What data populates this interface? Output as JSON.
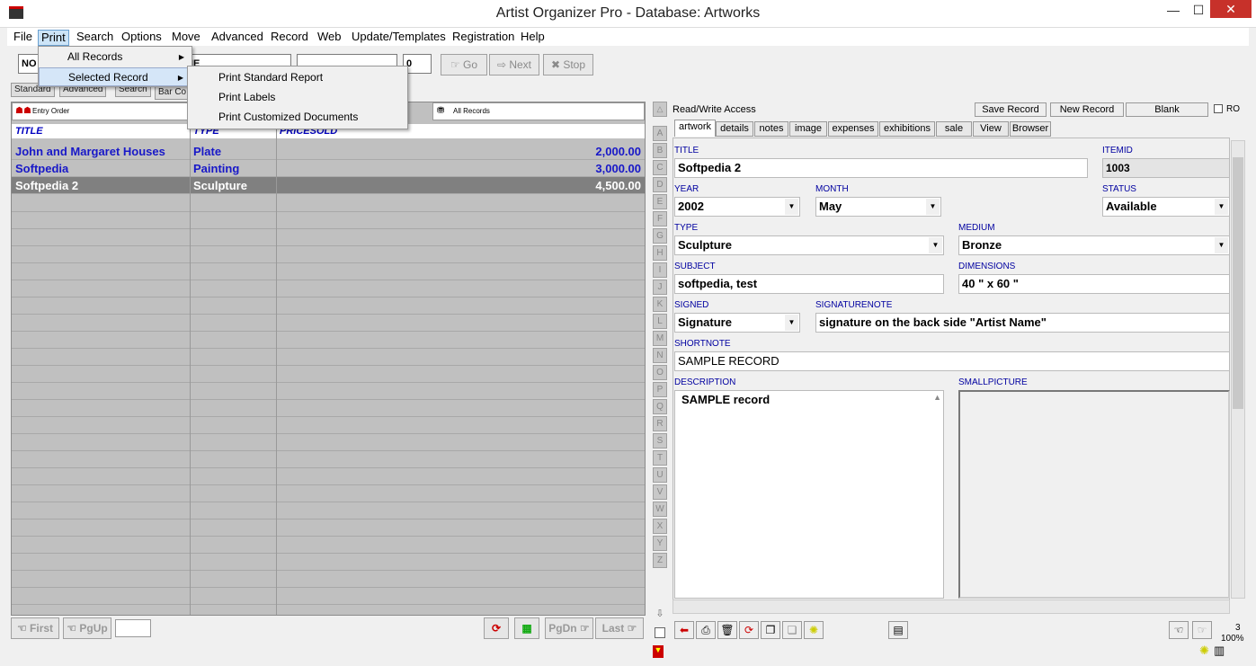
{
  "window": {
    "title": "Artist Organizer Pro - Database: Artworks",
    "minimize": "—",
    "maximize": "☐",
    "close": "✕"
  },
  "menu": [
    "File",
    "Print",
    "Search",
    "Options",
    "Move",
    "Advanced",
    "Record",
    "Web",
    "Update/Templates",
    "Registration",
    "Help"
  ],
  "print_menu": {
    "items": [
      "All Records",
      "Selected Record"
    ]
  },
  "print_submenu": {
    "items": [
      "Print Standard Report",
      "Print Labels",
      "Print Customized Documents"
    ]
  },
  "toolbar": {
    "field1": "NO",
    "field2": "IE",
    "field3": "0",
    "go": "Go",
    "next": "Next",
    "stop": "Stop"
  },
  "view_tabs": [
    "Standard",
    "Advanced",
    "Search",
    "Bar Co"
  ],
  "left": {
    "entry_order": "Entry Order",
    "all_records": "All Records",
    "headers": [
      "TITLE",
      "TYPE",
      "PRICESOLD"
    ],
    "rows": [
      {
        "title": "John and Margaret Houses",
        "type": "Plate",
        "price": "2,000.00"
      },
      {
        "title": "Softpedia",
        "type": "Painting",
        "price": "3,000.00"
      },
      {
        "title": "Softpedia 2",
        "type": "Sculpture",
        "price": "4,500.00"
      }
    ]
  },
  "nav": {
    "first": "First",
    "pgup": "PgUp",
    "pgdn": "PgDn",
    "last": "Last"
  },
  "alphabet": [
    "A",
    "B",
    "C",
    "D",
    "E",
    "F",
    "G",
    "H",
    "I",
    "J",
    "K",
    "L",
    "M",
    "N",
    "O",
    "P",
    "Q",
    "R",
    "S",
    "T",
    "U",
    "V",
    "W",
    "X",
    "Y",
    "Z"
  ],
  "right": {
    "access": "Read/Write Access",
    "save": "Save Record",
    "new": "New Record",
    "blank": "Blank",
    "ro": "RO",
    "tabs": [
      "artwork",
      "details",
      "notes",
      "image",
      "expenses",
      "exhibitions",
      "sale",
      "View",
      "Browser"
    ],
    "labels": {
      "title": "TITLE",
      "itemid": "ITEMID",
      "year": "YEAR",
      "month": "MONTH",
      "status": "STATUS",
      "type": "TYPE",
      "medium": "MEDIUM",
      "subject": "SUBJECT",
      "dimensions": "DIMENSIONS",
      "signed": "SIGNED",
      "signaturenote": "SIGNATURENOTE",
      "shortnote": "SHORTNOTE",
      "description": "DESCRIPTION",
      "smallpicture": "SMALLPICTURE"
    },
    "values": {
      "title": "Softpedia 2",
      "itemid": "1003",
      "year": "2002",
      "month": "May",
      "status": "Available",
      "type": "Sculpture",
      "medium": "Bronze",
      "subject": "softpedia, test",
      "dimensions": "40 \" x 60 \"",
      "signed": "Signature",
      "signaturenote": "signature on the back side \"Artist Name\"",
      "shortnote": "SAMPLE RECORD",
      "description": "SAMPLE record"
    }
  },
  "status": {
    "count": "3",
    "zoom": "100%"
  }
}
